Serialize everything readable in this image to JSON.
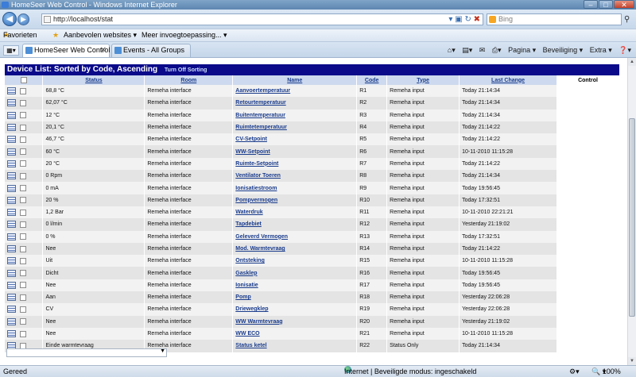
{
  "window": {
    "title": "HomeSeer Web Control - Windows Internet Explorer"
  },
  "address_bar": {
    "url": "http://localhost/stat",
    "search_placeholder": "Bing"
  },
  "favorites_bar": {
    "favorites": "Favorieten",
    "item1": "Aanbevolen websites ▾",
    "item2": "Meer invoegtoepassing... ▾"
  },
  "tabs": [
    {
      "label": "HomeSeer Web Control"
    },
    {
      "label": "Events - All Groups"
    }
  ],
  "command_bar": {
    "page": "Pagina ▾",
    "security": "Beveiliging ▾",
    "extra": "Extra ▾",
    "help": "❓▾"
  },
  "device_list": {
    "title": "Device List: Sorted by Code, Ascending",
    "sort_link": "Turn Off Sorting",
    "columns": {
      "status": "Status",
      "room": "Room",
      "name": "Name",
      "code": "Code",
      "type": "Type",
      "last_change": "Last Change",
      "control": "Control"
    },
    "rows": [
      {
        "status": "68,8 °C",
        "room": "Remeha interface",
        "name": "Aanvoertemperatuur",
        "code": "R1",
        "type": "Remeha input",
        "last_change": "Today 21:14:34"
      },
      {
        "status": "62,07 °C",
        "room": "Remeha interface",
        "name": "Retourtemperatuur",
        "code": "R2",
        "type": "Remeha input",
        "last_change": "Today 21:14:34"
      },
      {
        "status": "12 °C",
        "room": "Remeha interface",
        "name": "Buitentemperatuur",
        "code": "R3",
        "type": "Remeha input",
        "last_change": "Today 21:14:34"
      },
      {
        "status": "20,1 °C",
        "room": "Remeha interface",
        "name": "Ruimtetemperatuur",
        "code": "R4",
        "type": "Remeha input",
        "last_change": "Today 21:14:22"
      },
      {
        "status": "46,7 °C",
        "room": "Remeha interface",
        "name": "CV-Setpoint",
        "code": "R5",
        "type": "Remeha input",
        "last_change": "Today 21:14:22"
      },
      {
        "status": "60 °C",
        "room": "Remeha interface",
        "name": "WW-Setpoint",
        "code": "R6",
        "type": "Remeha input",
        "last_change": "10-11-2010 11:15:28"
      },
      {
        "status": "20 °C",
        "room": "Remeha interface",
        "name": "Ruimte-Setpoint",
        "code": "R7",
        "type": "Remeha input",
        "last_change": "Today 21:14:22"
      },
      {
        "status": "0 Rpm",
        "room": "Remeha interface",
        "name": "Ventilator Toeren",
        "code": "R8",
        "type": "Remeha input",
        "last_change": "Today 21:14:34"
      },
      {
        "status": "0 mA",
        "room": "Remeha interface",
        "name": "Ionisatiestroom",
        "code": "R9",
        "type": "Remeha input",
        "last_change": "Today 19:56:45"
      },
      {
        "status": "20 %",
        "room": "Remeha interface",
        "name": "Pompvermogen",
        "code": "R10",
        "type": "Remeha input",
        "last_change": "Today 17:32:51"
      },
      {
        "status": "1,2 Bar",
        "room": "Remeha interface",
        "name": "Waterdruk",
        "code": "R11",
        "type": "Remeha input",
        "last_change": "10-11-2010 22:21:21"
      },
      {
        "status": "0 l/min",
        "room": "Remeha interface",
        "name": "Tapdebiet",
        "code": "R12",
        "type": "Remeha input",
        "last_change": "Yesterday 21:19:02"
      },
      {
        "status": "0 %",
        "room": "Remeha interface",
        "name": "Geleverd Vermogen",
        "code": "R13",
        "type": "Remeha input",
        "last_change": "Today 17:32:51"
      },
      {
        "status": "Nee",
        "room": "Remeha interface",
        "name": "Mod. Warmtevraag",
        "code": "R14",
        "type": "Remeha input",
        "last_change": "Today 21:14:22"
      },
      {
        "status": "Uit",
        "room": "Remeha interface",
        "name": "Ontsteking",
        "code": "R15",
        "type": "Remeha input",
        "last_change": "10-11-2010 11:15:28"
      },
      {
        "status": "Dicht",
        "room": "Remeha interface",
        "name": "Gasklep",
        "code": "R16",
        "type": "Remeha input",
        "last_change": "Today 19:56:45"
      },
      {
        "status": "Nee",
        "room": "Remeha interface",
        "name": "Ionisatie",
        "code": "R17",
        "type": "Remeha input",
        "last_change": "Today 19:56:45"
      },
      {
        "status": "Aan",
        "room": "Remeha interface",
        "name": "Pomp",
        "code": "R18",
        "type": "Remeha input",
        "last_change": "Yesterday 22:06:28"
      },
      {
        "status": "CV",
        "room": "Remeha interface",
        "name": "Driewegklep",
        "code": "R19",
        "type": "Remeha input",
        "last_change": "Yesterday 22:06:28"
      },
      {
        "status": "Nee",
        "room": "Remeha interface",
        "name": "WW Warmtevraag",
        "code": "R20",
        "type": "Remeha input",
        "last_change": "Yesterday 21:19:02"
      },
      {
        "status": "Nee",
        "room": "Remeha interface",
        "name": "WW ECO",
        "code": "R21",
        "type": "Remeha input",
        "last_change": "10-11-2010 11:15:28"
      },
      {
        "status": "Einde warmtevraag",
        "room": "Remeha interface",
        "name": "Status ketel",
        "code": "R22",
        "type": "Status Only",
        "last_change": "Today 21:14:34"
      }
    ]
  },
  "status_bar": {
    "left": "Gereed",
    "zone": "Internet | Beveiligde modus: ingeschakeld",
    "zoom": "100%"
  },
  "colors": {
    "header_bg": "#0a0a8a",
    "link": "#1a3c8c",
    "col_header_bg": "#cdd9ee"
  }
}
